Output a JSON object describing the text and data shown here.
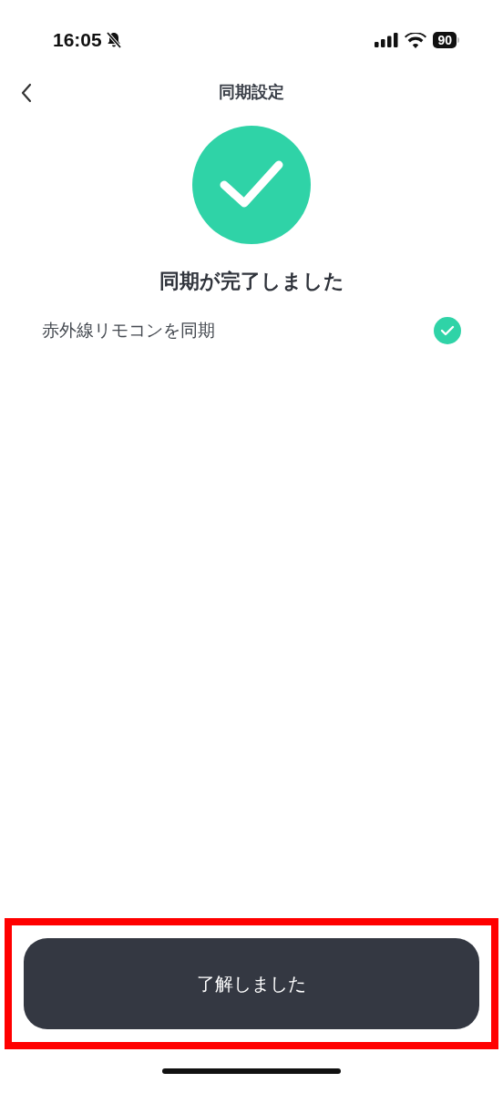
{
  "status_bar": {
    "time": "16:05",
    "silent": true,
    "battery": "90"
  },
  "nav": {
    "title": "同期設定"
  },
  "result": {
    "success": true,
    "heading": "同期が完了しました"
  },
  "items": [
    {
      "label": "赤外線リモコンを同期",
      "done": true
    }
  ],
  "button": {
    "label": "了解しました",
    "highlighted": true
  }
}
